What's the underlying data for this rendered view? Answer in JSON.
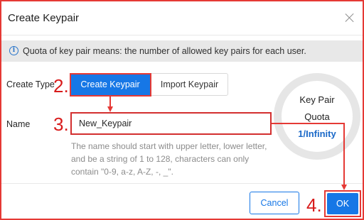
{
  "dialog": {
    "title": "Create Keypair",
    "close_icon": "close-icon"
  },
  "info": {
    "icon": "info-icon",
    "icon_glyph": "i",
    "text": "Quota of key pair means: the number of allowed key pairs for each user."
  },
  "form": {
    "create_type_label": "Create Type",
    "create_type_options": [
      {
        "label": "Create Keypair",
        "selected": true
      },
      {
        "label": "Import Keypair",
        "selected": false
      }
    ],
    "name_label": "Name",
    "name_value": "New_Keypair",
    "name_hint": "The name should start with upper letter, lower letter, and be a string of 1 to 128, characters can only contain \"0-9, a-z, A-Z, -, _\"."
  },
  "quota": {
    "title_line1": "Key Pair",
    "title_line2": "Quota",
    "value": "1/Infinity"
  },
  "footer": {
    "cancel_label": "Cancel",
    "ok_label": "OK"
  },
  "annotations": {
    "step2": "2.",
    "step3": "3.",
    "step4": "4.",
    "color": "#e53935"
  }
}
